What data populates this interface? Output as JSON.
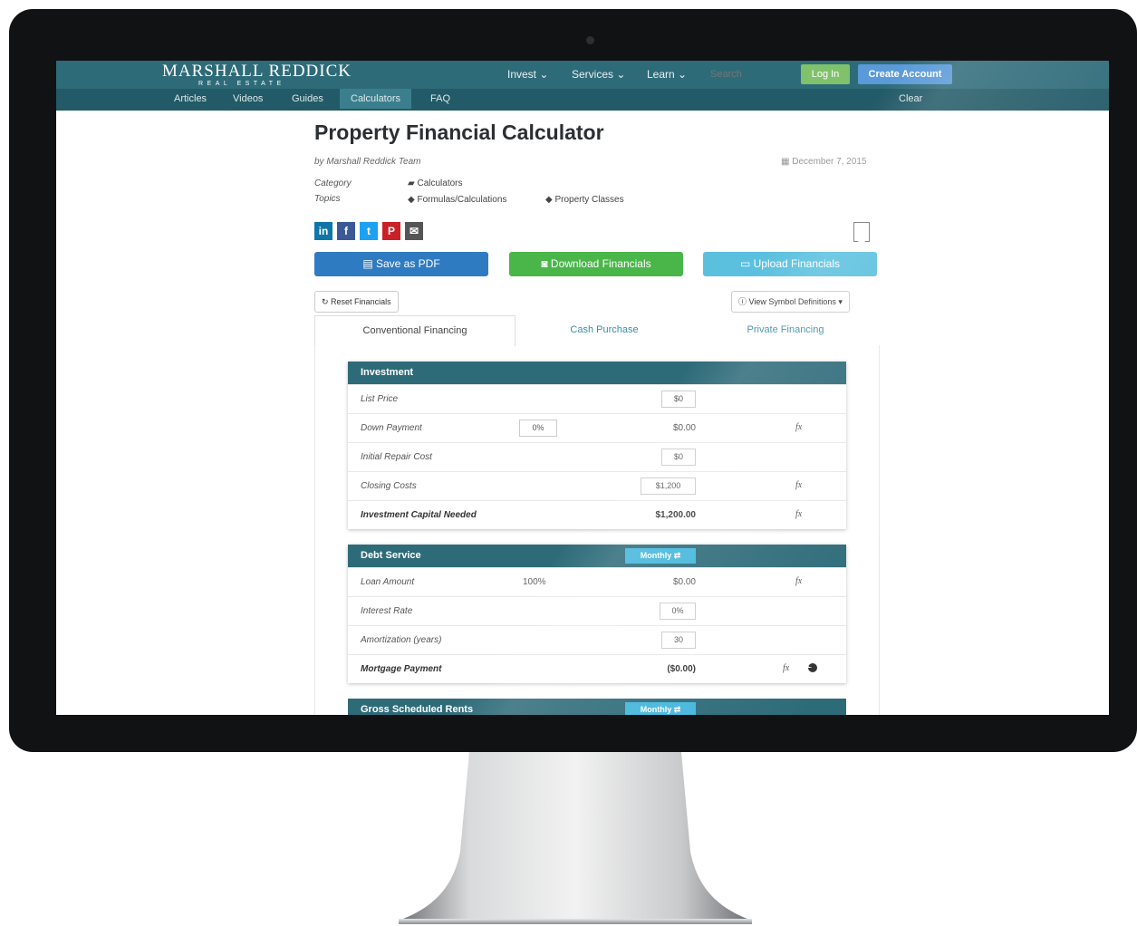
{
  "brand": {
    "name": "MARSHALL REDDICK",
    "sub": "REAL ESTATE"
  },
  "nav": {
    "invest": "Invest ⌄",
    "services": "Services ⌄",
    "learn": "Learn ⌄",
    "search_placeholder": "Search",
    "login": "Log In",
    "create_account": "Create Account"
  },
  "subnav": {
    "items": [
      "Articles",
      "Videos",
      "Guides",
      "Calculators",
      "FAQ"
    ],
    "clear": "Clear"
  },
  "page": {
    "title": "Property Financial Calculator",
    "byline": "by Marshall Reddick Team",
    "date": "December 7, 2015",
    "category_label": "Category",
    "category_value": "Calculators",
    "topics_label": "Topics",
    "topics": [
      "Formulas/Calculations",
      "Property Classes"
    ]
  },
  "share": {
    "linkedin": "in",
    "facebook": "f",
    "twitter": "t",
    "pinterest": "P",
    "email": "✉"
  },
  "actions": {
    "save_pdf": "Save as PDF",
    "download": "Download Financials",
    "upload": "Upload Financials",
    "reset": "Reset Financials",
    "symbols": "View Symbol Definitions"
  },
  "tabs": [
    "Conventional Financing",
    "Cash Purchase",
    "Private Financing"
  ],
  "investment": {
    "title": "Investment",
    "rows": [
      {
        "label": "List Price",
        "input": "$0"
      },
      {
        "label": "Down Payment",
        "input": "0%",
        "value": "$0.00"
      },
      {
        "label": "Initial Repair Cost",
        "input": "$0"
      },
      {
        "label": "Closing Costs",
        "input": "$1,200"
      },
      {
        "label": "Investment Capital Needed",
        "value": "$1,200.00"
      }
    ]
  },
  "debt": {
    "title": "Debt Service",
    "freq": "Monthly ⇄",
    "rows": [
      {
        "label": "Loan Amount",
        "pct": "100%",
        "value": "$0.00"
      },
      {
        "label": "Interest Rate",
        "input": "0%"
      },
      {
        "label": "Amortization (years)",
        "input": "30"
      },
      {
        "label": "Mortgage Payment",
        "value": "($0.00)"
      }
    ]
  },
  "rents": {
    "title": "Gross Scheduled Rents",
    "freq": "Monthly ⇄"
  },
  "fx_symbol": "fx",
  "colors": {
    "header": "#2e6b79",
    "subheader": "#225a67",
    "save": "#2f7bc2",
    "download": "#4ab64a",
    "upload": "#5bc0de",
    "negative": "#b22222"
  }
}
